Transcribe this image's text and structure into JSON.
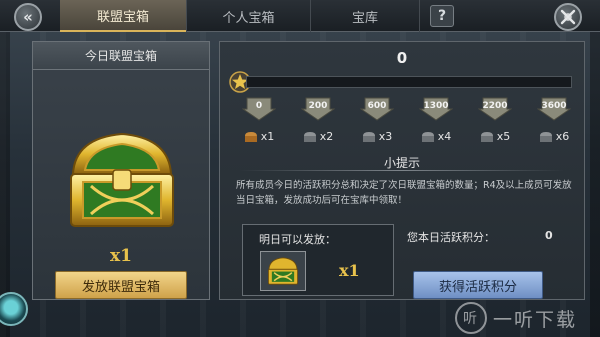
{
  "tabs": [
    {
      "label": "联盟宝箱",
      "active": true
    },
    {
      "label": "个人宝箱",
      "active": false
    },
    {
      "label": "宝库",
      "active": false
    }
  ],
  "top_buttons": {
    "back_icon": "double-chevron-left-icon",
    "help": "?",
    "close_icon": "crossed-swords-icon"
  },
  "left_panel": {
    "title": "今日联盟宝箱",
    "chest_quantity": "x1",
    "send_button": "发放联盟宝箱"
  },
  "right_panel": {
    "current_points": "0",
    "progress_fraction": 0,
    "milestones": [
      {
        "threshold": "0",
        "reward": "x1"
      },
      {
        "threshold": "200",
        "reward": "x2"
      },
      {
        "threshold": "600",
        "reward": "x3"
      },
      {
        "threshold": "1300",
        "reward": "x4"
      },
      {
        "threshold": "2200",
        "reward": "x5"
      },
      {
        "threshold": "3600",
        "reward": "x6"
      }
    ],
    "tip_title": "小提示",
    "tip_text": "所有成员今日的活跃积分总和决定了次日联盟宝箱的数量；R4及以上成员可发放当日宝箱，发放成功后可在宝库中领取！",
    "tomorrow_label": "明日可以发放：",
    "tomorrow_quantity": "x1",
    "today_points_label": "您本日活跃积分：",
    "today_points_value": "0",
    "get_points_button": "获得活跃积分"
  },
  "watermark": {
    "logo_text": "听",
    "text": "一听下载"
  },
  "colors": {
    "gold": "#e8c24c",
    "gold_button": "#cfa24a",
    "blue_button": "#6f8fc4",
    "panel": "#2f373e"
  }
}
